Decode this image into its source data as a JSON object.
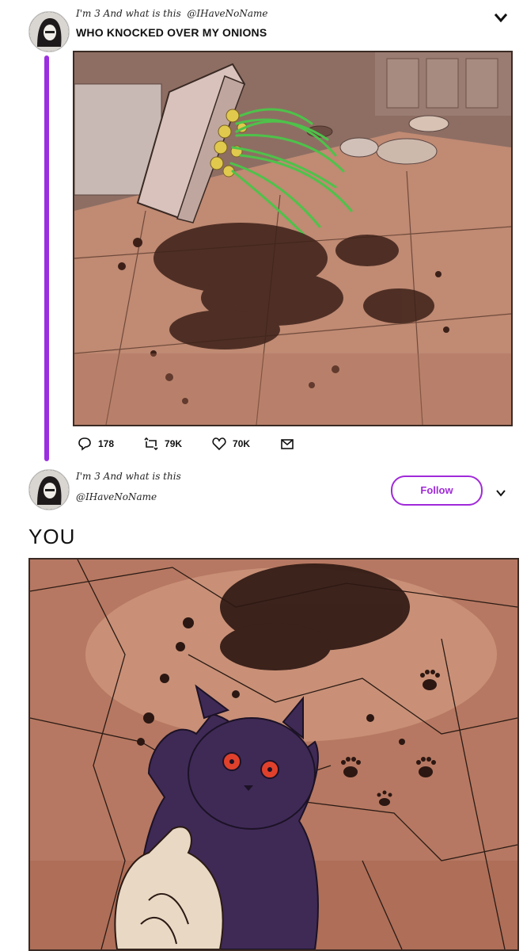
{
  "tweet1": {
    "display_name": "I'm 3 And what is this",
    "handle": "@IHaveNoName",
    "text": "WHO KNOCKED OVER MY ONIONS",
    "replies": "178",
    "retweets": "79K",
    "likes": "70K",
    "icons": [
      "chevron-down-icon",
      "reply-icon",
      "retweet-icon",
      "heart-icon",
      "mail-icon"
    ]
  },
  "tweet2": {
    "display_name": "I'm 3 And what is this",
    "handle": "@IHaveNoName",
    "follow_label": "Follow",
    "text": "YOU",
    "icons": [
      "chevron-down-icon"
    ]
  },
  "colors": {
    "thread_line": "#9b2fe0",
    "follow_accent": "#a02ad9",
    "floor": "#b77a61",
    "cat": "#3f2a56"
  }
}
